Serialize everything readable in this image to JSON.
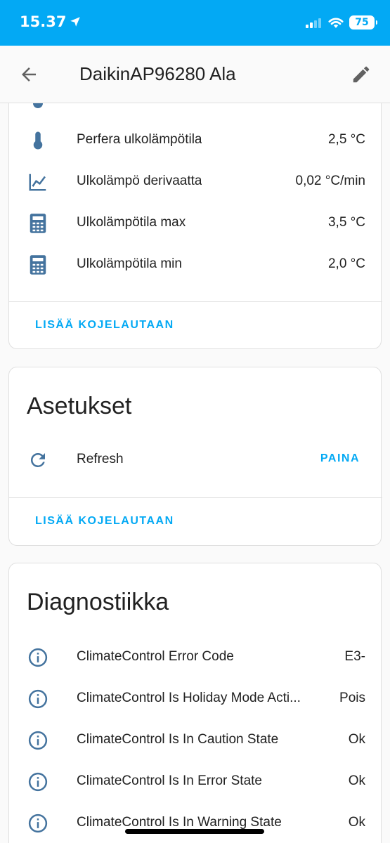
{
  "status_bar": {
    "time": "15.37",
    "battery": "75"
  },
  "app_bar": {
    "title": "DaikinAP96280 Ala"
  },
  "sensors_card": {
    "rows": [
      {
        "icon": "thermometer-icon",
        "label": "Perfera ulkolämpötila",
        "value": "2,5 °C"
      },
      {
        "icon": "chart-line-icon",
        "label": "Ulkolämpö derivaatta",
        "value": "0,02 °C/min"
      },
      {
        "icon": "calculator-icon",
        "label": "Ulkolämpötila max",
        "value": "3,5 °C"
      },
      {
        "icon": "calculator-icon",
        "label": "Ulkolämpötila min",
        "value": "2,0 °C"
      }
    ],
    "action": "LISÄÄ KOJELAUTAAN"
  },
  "settings_card": {
    "title": "Asetukset",
    "rows": [
      {
        "icon": "refresh-icon",
        "label": "Refresh",
        "button": "PAINA"
      }
    ],
    "action": "LISÄÄ KOJELAUTAAN"
  },
  "diagnostics_card": {
    "title": "Diagnostiikka",
    "rows": [
      {
        "icon": "info-icon",
        "label": "ClimateControl Error Code",
        "value": "E3-"
      },
      {
        "icon": "info-icon",
        "label": "ClimateControl Is Holiday Mode Acti...",
        "value": "Pois"
      },
      {
        "icon": "info-icon",
        "label": "ClimateControl Is In Caution State",
        "value": "Ok"
      },
      {
        "icon": "info-icon",
        "label": "ClimateControl Is In Error State",
        "value": "Ok"
      },
      {
        "icon": "info-icon",
        "label": "ClimateControl Is In Warning State",
        "value": "Ok"
      }
    ]
  },
  "colors": {
    "accent": "#03a9f4",
    "icon": "#44739e",
    "text": "#212121"
  }
}
